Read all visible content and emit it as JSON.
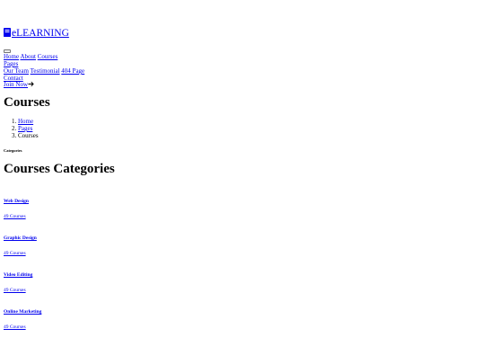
{
  "brand": {
    "icon": "book-icon",
    "name": "eLEARNING",
    "color": "#0000ee"
  },
  "nav": {
    "toggler_icon": "hamburger-icon",
    "home": "Home",
    "about": "About",
    "courses": "Courses",
    "pages": "Pages",
    "our_team": "Our Team",
    "testimonial": "Testimonial",
    "page_404": "404 Page",
    "contact": "Contact",
    "join_now": "Join Now",
    "join_icon": "arrow-right-icon"
  },
  "header": {
    "title": "Courses"
  },
  "breadcrumb": {
    "home": "Home",
    "pages": "Pages",
    "current": "Courses"
  },
  "categories_section": {
    "label": "Categories",
    "title": "Courses Categories",
    "items": [
      {
        "name": "Web Design",
        "count": "49 Courses"
      },
      {
        "name": "Graphic Design",
        "count": "49 Courses"
      },
      {
        "name": "Video Editing",
        "count": "49 Courses"
      },
      {
        "name": "Online Marketing",
        "count": "49 Courses"
      }
    ]
  }
}
